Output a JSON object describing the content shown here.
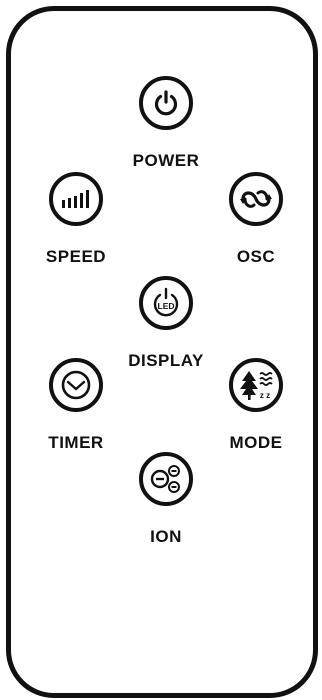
{
  "remote": {
    "buttons": {
      "power": {
        "label": "POWER",
        "icon": "power-icon"
      },
      "speed": {
        "label": "SPEED",
        "icon": "speed-bars-icon"
      },
      "osc": {
        "label": "OSC",
        "icon": "oscillation-arrows-icon"
      },
      "display": {
        "label": "DISPLAY",
        "icon": "led-display-icon",
        "icon_text": "LED"
      },
      "timer": {
        "label": "TIMER",
        "icon": "timer-icon"
      },
      "mode": {
        "label": "MODE",
        "icon": "sleep-mode-icon",
        "icon_text": "z z"
      },
      "ion": {
        "label": "ION",
        "icon": "ion-icon"
      }
    },
    "colors": {
      "ink": "#111111",
      "background": "#ffffff"
    }
  }
}
